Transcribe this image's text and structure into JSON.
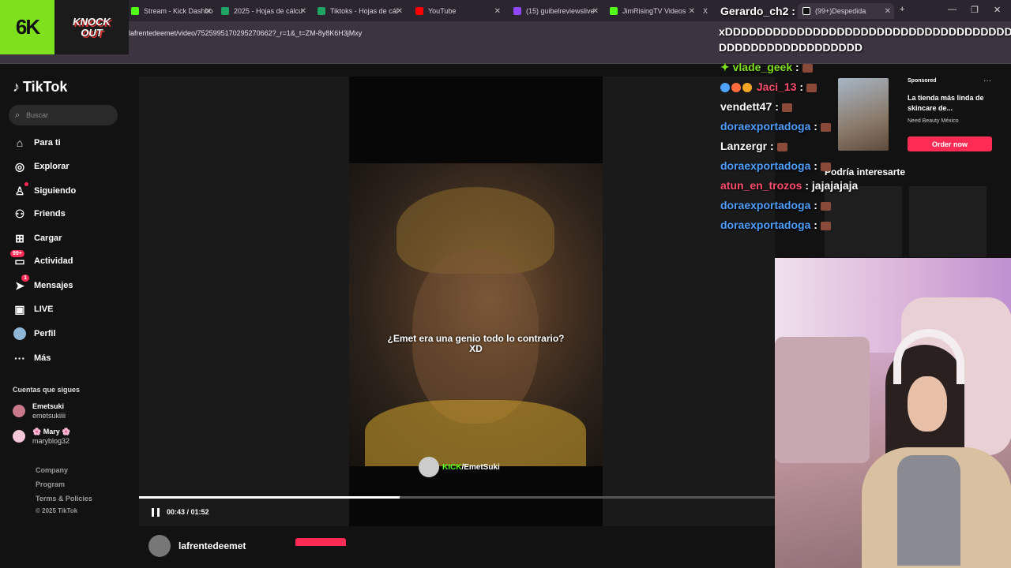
{
  "browser": {
    "tabs": [
      {
        "title": "Stream - Kick Dashbo",
        "color": "#53fc18"
      },
      {
        "title": "2025 - Hojas de cálcu",
        "color": "#1fa463"
      },
      {
        "title": "Tiktoks - Hojas de cál",
        "color": "#1fa463"
      },
      {
        "title": "YouTube",
        "color": "#ff0000"
      },
      {
        "title": "(15) guibelreviewslive",
        "color": "#9146ff"
      },
      {
        "title": "JimRisingTV Videos",
        "color": "#53fc18"
      },
      {
        "title": "X",
        "color": "#000000"
      },
      {
        "title": "(99+)Despedida",
        "color": "#ffffff"
      }
    ],
    "new_tab": "+",
    "url": "lafrentedeemet/video/7525995170295270662?_r=1&_t=ZM-8y8K6H3jMxy"
  },
  "overlay": {
    "logo1": "6K",
    "logo2_line1": "KNOCK",
    "logo2_line2": "OUT"
  },
  "tiktok": {
    "brand": "TikTok",
    "search_placeholder": "Buscar",
    "nav": [
      {
        "label": "Para ti",
        "icon": "home-icon"
      },
      {
        "label": "Explorar",
        "icon": "compass-icon"
      },
      {
        "label": "Siguiendo",
        "icon": "following-icon"
      },
      {
        "label": "Friends",
        "icon": "friends-icon"
      },
      {
        "label": "Cargar",
        "icon": "upload-icon"
      },
      {
        "label": "Actividad",
        "icon": "activity-icon",
        "badge": "99+"
      },
      {
        "label": "Mensajes",
        "icon": "messages-icon",
        "badge": "1"
      },
      {
        "label": "LIVE",
        "icon": "live-icon"
      },
      {
        "label": "Perfil",
        "icon": "profile-icon"
      },
      {
        "label": "Más",
        "icon": "more-icon"
      }
    ],
    "following_heading": "Cuentas que sigues",
    "following": [
      {
        "name": "Emetsuki",
        "handle": "emetsukiiii"
      },
      {
        "name": "🌸 Mary 🌸",
        "handle": "maryblog32"
      }
    ],
    "footer": [
      "Company",
      "Program",
      "Terms & Policies"
    ],
    "copyright": "© 2025 TikTok",
    "video": {
      "subtitle_line1": "¿Emet era una genio todo lo contrario?",
      "subtitle_line2": "XD",
      "watermark_kick": "KICK",
      "watermark_user": "/EmetSuki",
      "current_time": "00:43",
      "duration": "01:52",
      "progress": 0.41,
      "author": "lafrentedeemet"
    },
    "ad": {
      "sponsored": "Sponsored",
      "more": "···",
      "title": "La tienda más linda de skincare de...",
      "brand": "Need Beauty México",
      "cta": "Order now"
    },
    "suggestion_heading": "Podría interesarte"
  },
  "chat": {
    "first_user": "Gerardo_ch2",
    "first_message_line1": "xDDDDDDDDDDDDDDDDDDDDDDDDDDDDDDDDDDDDDDD",
    "first_message_line2": "DDDDDDDDDDDDDDDDDD",
    "messages": [
      {
        "user": "vlade_geek",
        "color": "#7fe01e",
        "text": ""
      },
      {
        "user": "Jaci_13",
        "color": "#ff4d6d",
        "text": ""
      },
      {
        "user": "vendett47",
        "color": "#ffffff",
        "text": ""
      },
      {
        "user": "doraexportadoga",
        "color": "#4d9eff",
        "text": ""
      },
      {
        "user": "Lanzergr",
        "color": "#ffffff",
        "text": ""
      },
      {
        "user": "doraexportadoga",
        "color": "#4d9eff",
        "text": ""
      },
      {
        "user": "atun_en_trozos",
        "color": "#ff4d6d",
        "text": "jajajajaja"
      },
      {
        "user": "doraexportadoga",
        "color": "#4d9eff",
        "text": ""
      },
      {
        "user": "doraexportadoga",
        "color": "#4d9eff",
        "text": ""
      }
    ]
  },
  "colors": {
    "accent": "#fe2c55",
    "kick_green": "#53fc18"
  }
}
